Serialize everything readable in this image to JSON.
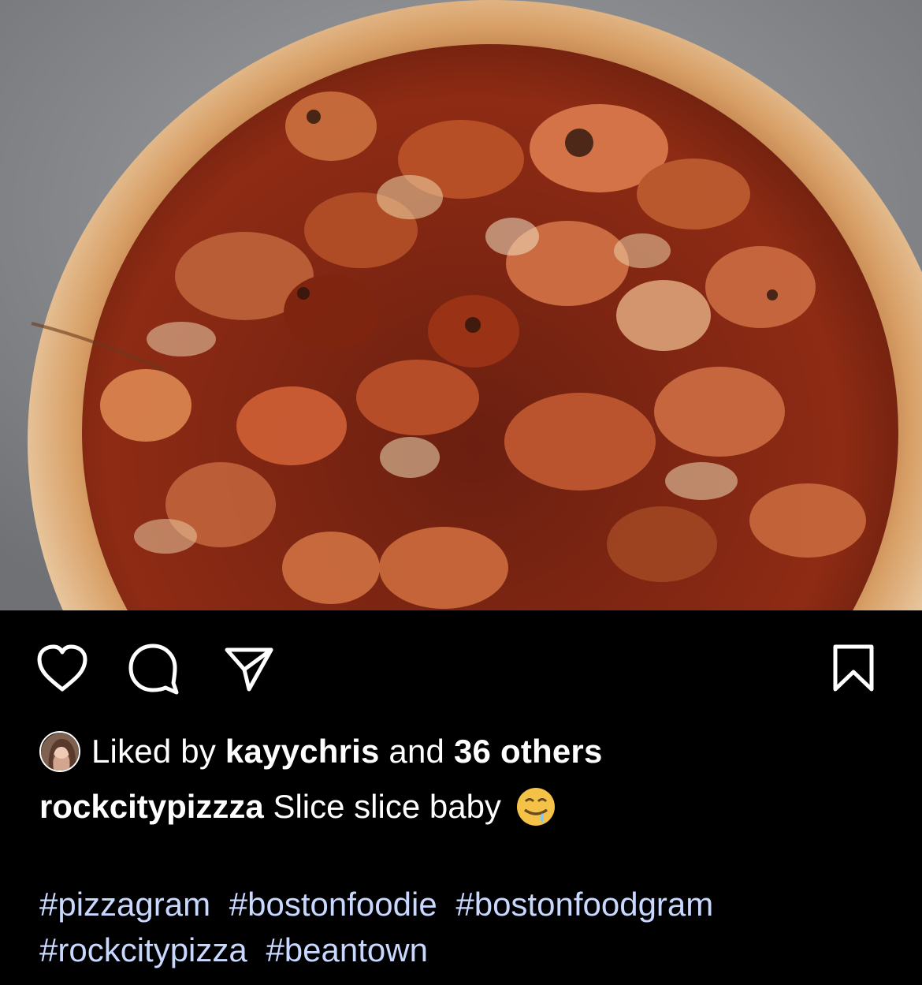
{
  "post": {
    "image_alt": "BBQ chicken pizza",
    "likes": {
      "prefix": "Liked by",
      "user": "kayychris",
      "middle": "and",
      "others": "36 others"
    },
    "caption": {
      "username": "rockcitypizzza",
      "text": "Slice slice baby"
    },
    "hashtags": [
      "#pizzagram",
      "#bostonfoodie",
      "#bostonfoodgram",
      "#rockcitypizza",
      "#beantown"
    ]
  },
  "icons": {
    "like": "heart-icon",
    "comment": "comment-icon",
    "share": "share-icon",
    "save": "bookmark-icon",
    "emoji": "drooling-face-emoji"
  },
  "colors": {
    "background": "#000000",
    "text": "#ffffff",
    "hashtag": "#c8d8ff"
  }
}
